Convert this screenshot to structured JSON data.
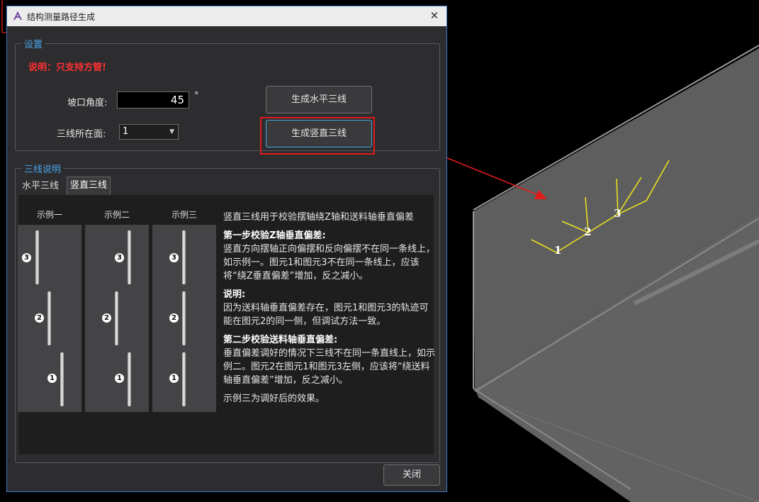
{
  "dialog": {
    "title": "结构测量路径生成",
    "close_glyph": "✕"
  },
  "settings": {
    "group_title": "设置",
    "notice": "说明：只支持方管!",
    "angle_label": "坡口角度:",
    "angle_value": "45",
    "angle_unit": "°",
    "face_label": "三线所在面:",
    "face_value": "1",
    "btn_horizontal": "生成水平三线",
    "btn_vertical": "生成竖直三线"
  },
  "explain": {
    "group_title": "三线说明",
    "tabs": [
      "水平三线",
      "竖直三线"
    ],
    "active_tab": "竖直三线",
    "examples": [
      "示例一",
      "示例二",
      "示例三"
    ],
    "markers": [
      "3",
      "2",
      "1"
    ],
    "intro": "竖直三线用于校验摆轴绕Z轴和送料轴垂直偏差",
    "step1_title": "第一步校验Z轴垂直偏差:",
    "step1_text": "竖直方向摆轴正向偏摆和反向偏摆不在同一条线上，如示例一。图元1和图元3不在同一条线上，应该将“绕Z垂直偏差”增加，反之减小。",
    "note_title": "说明:",
    "note_text": "因为送料轴垂直偏差存在，图元1和图元3的轨迹可能在图元2的同一侧，但调试方法一致。",
    "step2_title": "第二步校验送料轴垂直偏差:",
    "step2_text": "垂直偏差调好的情况下三线不在同一条直线上，如示例二。图元2在图元1和图元3左侧，应该将“绕送料轴垂直偏差”增加，反之减小。",
    "final_text": "示例三为调好后的效果。"
  },
  "footer": {
    "close_label": "关闭"
  },
  "viewport": {
    "labels": [
      "1",
      "2",
      "3"
    ],
    "line_color": "#e8e020",
    "arrow_color": "#e21a1a"
  }
}
